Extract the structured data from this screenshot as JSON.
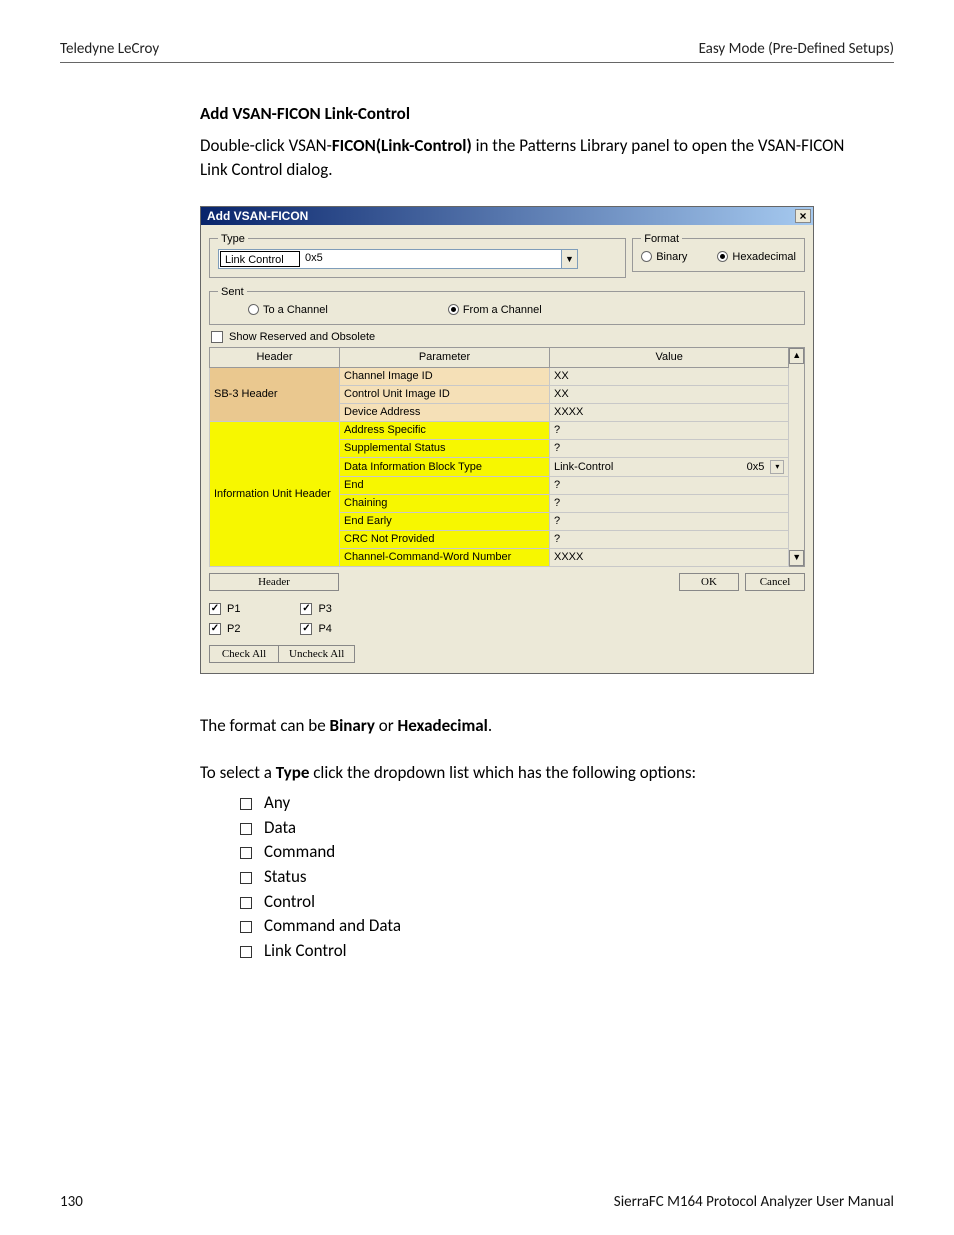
{
  "page": {
    "header_left": "Teledyne LeCroy",
    "header_right": "Easy Mode (Pre-Defined Setups)",
    "footer_page": "130",
    "footer_doc": "SierraFC M164 Protocol Analyzer User Manual"
  },
  "section": {
    "title": "Add VSAN-FICON Link-Control",
    "intro_pre": "Double-click VSAN-",
    "intro_bold": "FICON(Link-Control)",
    "intro_post": " in the Patterns Library panel to open the VSAN-FICON Link Control dialog.",
    "fmt_pre": "The format can be ",
    "fmt_b1": "Binary",
    "fmt_mid": " or ",
    "fmt_b2": "Hexadecimal",
    "fmt_post": ".",
    "type_pre": "To select a ",
    "type_b": "Type",
    "type_post": " click the dropdown list which has the following options:",
    "options": [
      "Any",
      "Data",
      "Command",
      "Status",
      "Control",
      "Command and Data",
      "Link Control"
    ]
  },
  "dialog": {
    "title": "Add VSAN-FICON",
    "type_legend": "Type",
    "type_selected": "Link Control",
    "type_code": "0x5",
    "format_legend": "Format",
    "format_binary": "Binary",
    "format_hex": "Hexadecimal",
    "sent_legend": "Sent",
    "sent_to": "To a Channel",
    "sent_from": "From a Channel",
    "show_reserved": "Show Reserved and Obsolete",
    "cols": {
      "header": "Header",
      "param": "Parameter",
      "value": "Value"
    },
    "rows": [
      {
        "group": "sb3",
        "grouplabel": "SB-3 Header",
        "param": "Channel Image ID",
        "paramClass": "param-orange",
        "value": "XX"
      },
      {
        "group": "sb3",
        "param": "Control Unit Image ID",
        "paramClass": "param-orange",
        "value": "XX"
      },
      {
        "group": "sb3",
        "param": "Device Address",
        "paramClass": "param-orange",
        "value": "XXXX"
      },
      {
        "group": "iu",
        "grouplabel": "Information Unit Header",
        "param": "Address Specific",
        "paramClass": "param-yellow",
        "value": "?"
      },
      {
        "group": "iu",
        "param": "Supplemental Status",
        "paramClass": "param-yellow",
        "value": "?"
      },
      {
        "group": "iu",
        "param": "Data Information Block Type",
        "paramClass": "param-yellow",
        "valueCombo": true,
        "valueLeft": "Link-Control",
        "valueRight": "0x5"
      },
      {
        "group": "iu",
        "param": "End",
        "paramClass": "param-yellow",
        "value": "?"
      },
      {
        "group": "iu",
        "param": "Chaining",
        "paramClass": "param-yellow",
        "value": "?"
      },
      {
        "group": "iu",
        "param": "End Early",
        "paramClass": "param-yellow",
        "value": "?"
      },
      {
        "group": "iu",
        "param": "CRC Not Provided",
        "paramClass": "param-yellow",
        "value": "?"
      },
      {
        "group": "iu",
        "param": "Channel-Command-Word Number",
        "paramClass": "param-yellow",
        "value": "XXXX"
      }
    ],
    "header_btn": "Header",
    "ok": "OK",
    "cancel": "Cancel",
    "ports": [
      "P1",
      "P2",
      "P3",
      "P4"
    ],
    "check_all": "Check All",
    "uncheck_all": "Uncheck All"
  }
}
